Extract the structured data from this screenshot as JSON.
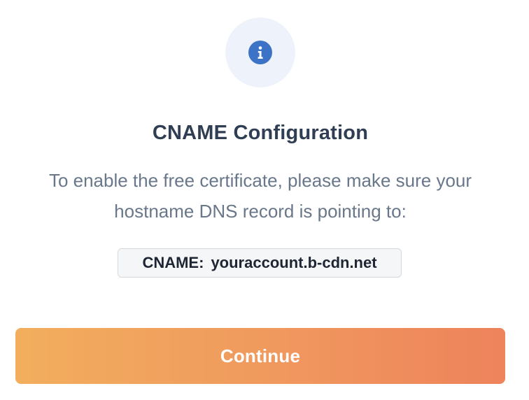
{
  "dialog": {
    "icon": "info-icon",
    "title": "CNAME Configuration",
    "message_line1": "To enable the free certificate, please make sure your",
    "message_line2": "hostname DNS record is pointing to:",
    "record": {
      "label": "CNAME:",
      "value": "youraccount.b-cdn.net"
    },
    "continue_label": "Continue"
  },
  "colors": {
    "title": "#2f3e52",
    "message": "#69778a",
    "icon_bg": "#eef3fb",
    "icon_fg": "#3c73c6",
    "button_gradient_start": "#f2ae5d",
    "button_gradient_end": "#ee835c"
  }
}
